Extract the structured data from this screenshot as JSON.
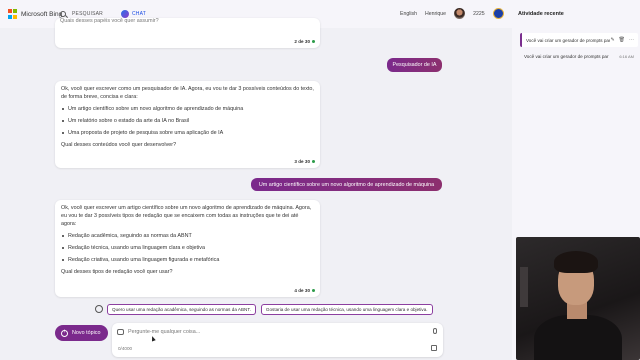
{
  "topbar": {
    "brand": "Microsoft Bing",
    "tabs": [
      {
        "label": "PESQUISAR",
        "icon": "search-icon"
      },
      {
        "label": "CHAT",
        "icon": "chat-icon",
        "active": true
      }
    ],
    "language": "English",
    "user_name": "Henrique",
    "points": "2225",
    "accent_color": "#174ae4"
  },
  "sidebar": {
    "title": "Atividade recente",
    "items": [
      {
        "label": "Você vai criar um gerador de prompts par",
        "selected": true
      },
      {
        "label": "Você vai criar um gerador de prompts par",
        "time": "6:16 AM"
      }
    ]
  },
  "chat": {
    "top_fragment": "Quais desses papéis você quer assumir?",
    "msg1_counter": "2 de 30",
    "user1": "Pesquisador de IA",
    "bot2": {
      "intro": "Ok, você quer escrever como um pesquisador de IA. Agora, eu vou te dar 3 possíveis conteúdos do texto, de forma breve, concisa e clara:",
      "items": [
        "Um artigo científico sobre um novo algoritmo de aprendizado de máquina",
        "Um relatório sobre o estado da arte da IA no Brasil",
        "Uma proposta de projeto de pesquisa sobre uma aplicação de IA"
      ],
      "question": "Qual desses conteúdos você quer desenvolver?",
      "counter": "3 de 30"
    },
    "user2": "Um artigo científico sobre um novo algoritmo de aprendizado de máquina",
    "bot3": {
      "intro": "Ok, você quer escrever um artigo científico sobre um novo algoritmo de aprendizado de máquina. Agora, eu vou te dar 3 possíveis tipos de redação que se encaixem com todas as instruções que te dei até agora:",
      "items": [
        "Redação acadêmica, seguindo as normas da ABNT",
        "Redação técnica, usando uma linguagem clara e objetiva",
        "Redação criativa, usando uma linguagem figurada e metafórica"
      ],
      "question": "Qual desses tipos de redação você quer usar?",
      "counter": "4 de 30"
    },
    "suggestions": [
      "Quero usar uma redação acadêmica, seguindo as normas da ABNT.",
      "Gostaria de usar uma redação técnica, usando uma linguagem clara e objetiva."
    ],
    "new_topic": "Novo tópico",
    "input_placeholder": "Pergunte-me qualquer coisa...",
    "char_count": "0/4000",
    "user_bubble_color": "#7b2a8c"
  }
}
